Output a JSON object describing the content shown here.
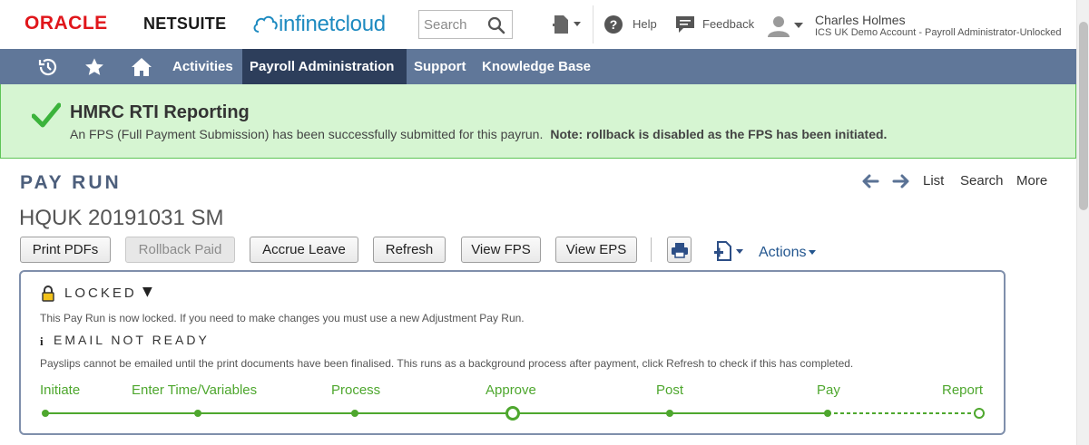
{
  "header": {
    "oracle_logo": "ORACLE",
    "netsuite_logo": "NETSUITE",
    "brand": "infinetcloud",
    "search_placeholder": "Search",
    "help_label": "Help",
    "feedback_label": "Feedback",
    "user_name": "Charles Holmes",
    "user_role": "ICS UK Demo Account - Payroll Administrator-Unlocked"
  },
  "nav": {
    "items": [
      {
        "label": "Activities",
        "active": false
      },
      {
        "label": "Payroll Administration",
        "active": true
      },
      {
        "label": "Support",
        "active": false
      },
      {
        "label": "Knowledge Base",
        "active": false
      }
    ],
    "icons": [
      "recent-records-icon",
      "star-icon",
      "home-icon"
    ]
  },
  "banner": {
    "title": "HMRC RTI Reporting",
    "message": "An FPS (Full Payment Submission) has been successfully submitted for this payrun.",
    "note": "Note: rollback is disabled as the FPS has been initiated.",
    "color": "#d6f5d2"
  },
  "record": {
    "type": "PAY RUN",
    "name": "HQUK 20191031 SM",
    "links": {
      "list": "List",
      "search": "Search",
      "more": "More"
    }
  },
  "buttons": {
    "print_pdfs": "Print PDFs",
    "rollback_paid": "Rollback Paid",
    "accrue_leave": "Accrue Leave",
    "refresh": "Refresh",
    "view_fps": "View FPS",
    "view_eps": "View EPS",
    "actions": "Actions"
  },
  "status": {
    "locked_label": "LOCKED",
    "locked_caret": "▼",
    "locked_message": "This Pay Run is now locked. If you need to make changes you must use a new Adjustment Pay Run.",
    "info_icon": "i",
    "email_label": "EMAIL NOT READY",
    "email_message": "Payslips cannot be emailed until the print documents have been finalised. This runs as a background process after payment, click Refresh to check if this has completed.",
    "steps": [
      {
        "label": "Initiate",
        "state": "done"
      },
      {
        "label": "Enter Time/Variables",
        "state": "done"
      },
      {
        "label": "Process",
        "state": "done"
      },
      {
        "label": "Approve",
        "state": "current"
      },
      {
        "label": "Post",
        "state": "done"
      },
      {
        "label": "Pay",
        "state": "done"
      },
      {
        "label": "Report",
        "state": "pending"
      }
    ],
    "accent_color": "#4ea72e"
  }
}
